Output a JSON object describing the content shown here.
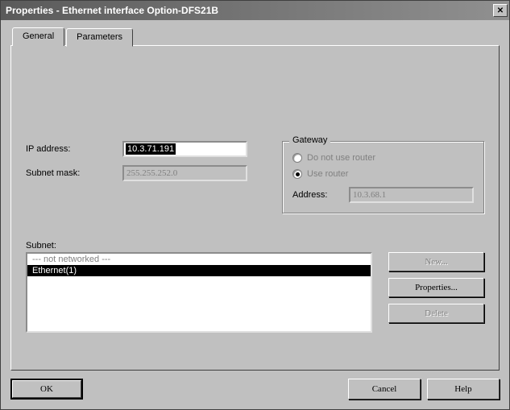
{
  "window": {
    "title": "Properties - Ethernet interface  Option-DFS21B",
    "close_glyph": "✕"
  },
  "tabs": {
    "general": "General",
    "parameters": "Parameters"
  },
  "fields": {
    "ip_label": "IP address:",
    "ip_value": "10.3.71.191",
    "subnet_mask_label": "Subnet mask:",
    "subnet_mask_value": "255.255.252.0"
  },
  "gateway": {
    "title": "Gateway",
    "no_router_label": "Do not use router",
    "use_router_label": "Use router",
    "address_label": "Address:",
    "address_value": "10.3.68.1",
    "selected": "use"
  },
  "subnet": {
    "label": "Subnet:",
    "items": [
      {
        "label": "--- not networked ---",
        "selected": false
      },
      {
        "label": "Ethernet(1)",
        "selected": true
      }
    ]
  },
  "buttons": {
    "new": "New...",
    "properties": "Properties...",
    "delete": "Delete",
    "ok": "OK",
    "cancel": "Cancel",
    "help": "Help"
  }
}
